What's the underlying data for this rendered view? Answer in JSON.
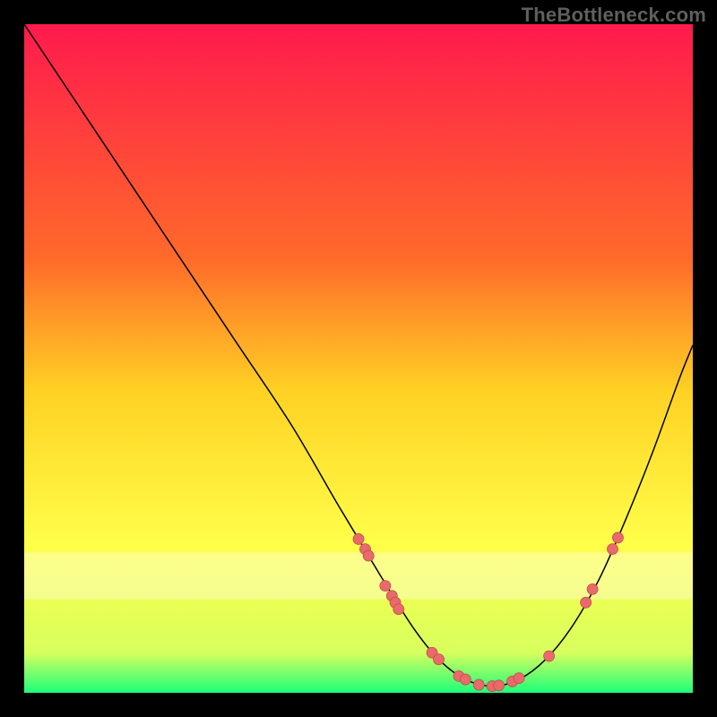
{
  "watermark": "TheBottleneck.com",
  "chart_data": {
    "type": "line",
    "title": "",
    "xlabel": "",
    "ylabel": "",
    "xlim": [
      0,
      100
    ],
    "ylim": [
      0,
      100
    ],
    "grid": false,
    "gradient_stops": [
      {
        "offset": 0,
        "color": "#ff1a4d"
      },
      {
        "offset": 35,
        "color": "#ff6a2a"
      },
      {
        "offset": 55,
        "color": "#ffd224"
      },
      {
        "offset": 78,
        "color": "#ffff4a"
      },
      {
        "offset": 94,
        "color": "#d7ff5e"
      },
      {
        "offset": 100,
        "color": "#1dff7a"
      }
    ],
    "highlight_band": {
      "y_from": 79,
      "y_to": 86,
      "color": "#fffde0",
      "opacity": 0.42
    },
    "series": [
      {
        "name": "curve",
        "color": "#000000",
        "width": 1.5,
        "points": [
          {
            "x": 0,
            "y": 0
          },
          {
            "x": 8,
            "y": 12
          },
          {
            "x": 16,
            "y": 24
          },
          {
            "x": 24,
            "y": 36
          },
          {
            "x": 32,
            "y": 48
          },
          {
            "x": 40,
            "y": 60
          },
          {
            "x": 47,
            "y": 72
          },
          {
            "x": 53,
            "y": 82
          },
          {
            "x": 58,
            "y": 90
          },
          {
            "x": 62,
            "y": 95
          },
          {
            "x": 66,
            "y": 98
          },
          {
            "x": 70,
            "y": 99
          },
          {
            "x": 74,
            "y": 98
          },
          {
            "x": 78,
            "y": 95
          },
          {
            "x": 82,
            "y": 90
          },
          {
            "x": 86,
            "y": 83
          },
          {
            "x": 90,
            "y": 74
          },
          {
            "x": 94,
            "y": 64
          },
          {
            "x": 98,
            "y": 53
          },
          {
            "x": 100,
            "y": 48
          }
        ]
      }
    ],
    "markers": {
      "color": "#e86a6a",
      "stroke": "#c24d4d",
      "r": 6,
      "points": [
        {
          "x": 50,
          "y": 77
        },
        {
          "x": 51,
          "y": 78.5
        },
        {
          "x": 51.5,
          "y": 79.5
        },
        {
          "x": 54,
          "y": 84
        },
        {
          "x": 55,
          "y": 85.5
        },
        {
          "x": 55.5,
          "y": 86.5
        },
        {
          "x": 56,
          "y": 87.5
        },
        {
          "x": 61,
          "y": 94
        },
        {
          "x": 62,
          "y": 95
        },
        {
          "x": 65,
          "y": 97.5
        },
        {
          "x": 66,
          "y": 98
        },
        {
          "x": 68,
          "y": 98.8
        },
        {
          "x": 70,
          "y": 99
        },
        {
          "x": 71,
          "y": 98.9
        },
        {
          "x": 73,
          "y": 98.3
        },
        {
          "x": 74,
          "y": 97.8
        },
        {
          "x": 78.5,
          "y": 94.5
        },
        {
          "x": 84,
          "y": 86.5
        },
        {
          "x": 85,
          "y": 84.5
        },
        {
          "x": 88,
          "y": 78.5
        },
        {
          "x": 88.8,
          "y": 76.8
        }
      ]
    }
  }
}
